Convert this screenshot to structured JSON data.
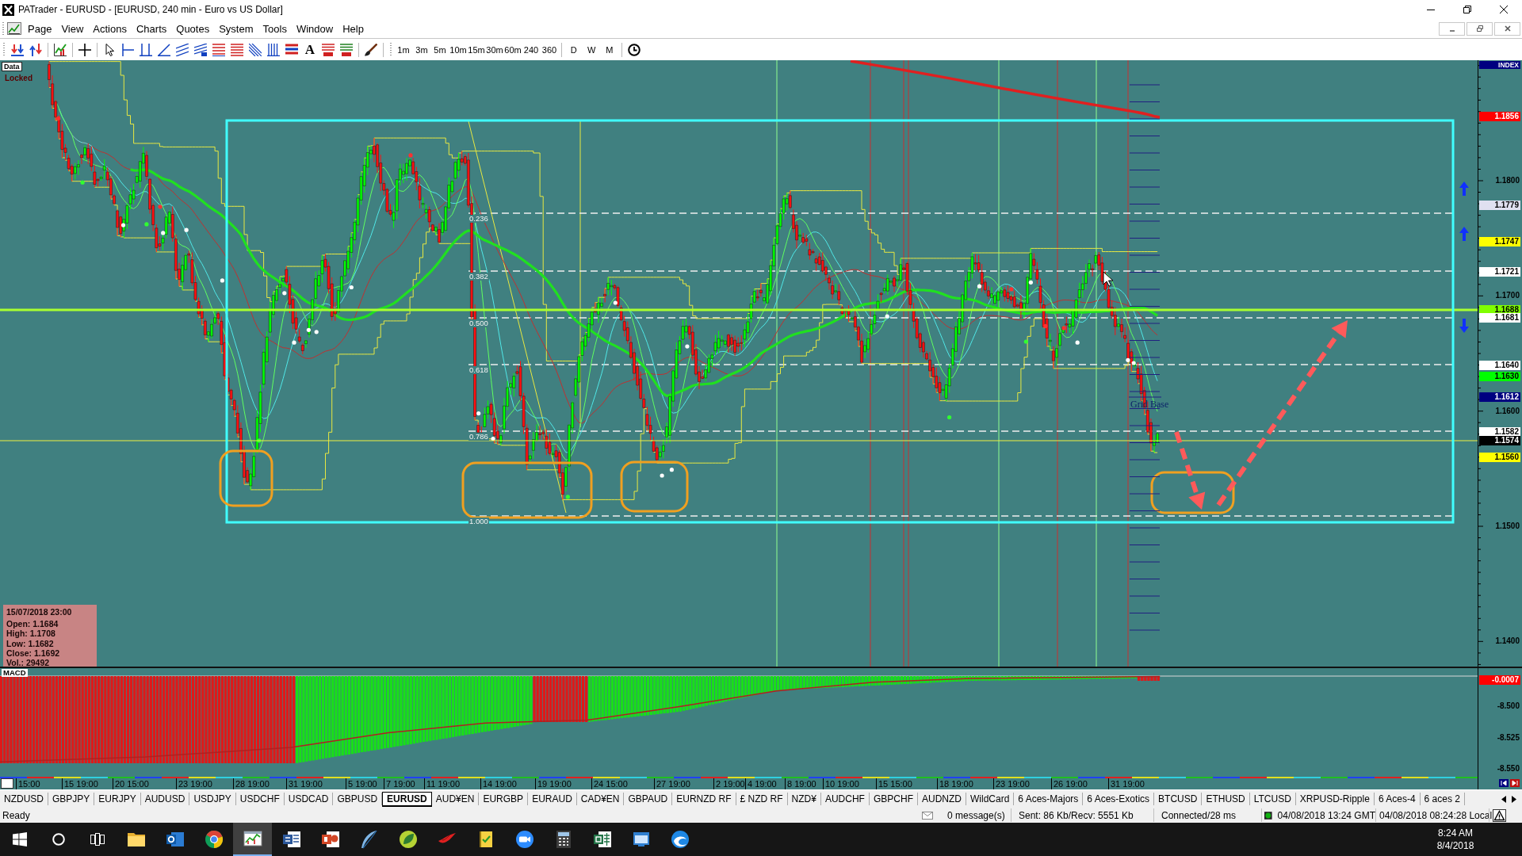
{
  "window": {
    "title": "PATrader - EURUSD - [EURUSD, 240 min - Euro vs US Dollar]"
  },
  "menu": [
    "Page",
    "View",
    "Actions",
    "Charts",
    "Quotes",
    "System",
    "Tools",
    "Window",
    "Help"
  ],
  "toolbar": {
    "text_tool": "A",
    "timeframes": [
      "1m",
      "3m",
      "5m",
      "10m",
      "15m",
      "30m",
      "60m",
      "240",
      "360"
    ],
    "periods": [
      "D",
      "W",
      "M"
    ]
  },
  "chart": {
    "corner": {
      "label": "Data",
      "lock_state": "Locked"
    },
    "price_axis": {
      "header": "INDEX",
      "ticks": [
        "1.1800",
        "1.1700",
        "1.1600",
        "1.1500",
        "1.1400"
      ],
      "markers": [
        {
          "label": "1.1856",
          "color": "#ff0000"
        },
        {
          "label": "1.1779",
          "color": "#e0e0f0"
        },
        {
          "label": "1.1747",
          "color": "#ffff00"
        },
        {
          "label": "1.1721",
          "color": "#ffffff"
        },
        {
          "label": "1.1688",
          "color": "#80ff00"
        },
        {
          "label": "1.1681",
          "color": "#ffffff"
        },
        {
          "label": "1.1640",
          "color": "#ffffff"
        },
        {
          "label": "1.1630",
          "color": "#00ff00"
        },
        {
          "label": "1.1612",
          "color": "#000080"
        },
        {
          "label": "1.1582",
          "color": "#ffffff"
        },
        {
          "label": "1.1574",
          "color": "#000000"
        },
        {
          "label": "1.1560",
          "color": "#ffff00"
        }
      ]
    },
    "fib_levels": [
      "0.236",
      "0.382",
      "0.500",
      "0.618",
      "0.786",
      "1.000"
    ],
    "grid_label": "Grid Base",
    "info_box": {
      "timestamp": "15/07/2018 23:00",
      "lines": [
        "Open: 1.1684",
        "High: 1.1708",
        "Low: 1.1682",
        "Close: 1.1692",
        "Vol.: 29492"
      ]
    },
    "macd": {
      "label": "MACD",
      "ticks": [
        "-8.500",
        "-8.525",
        "-8.550"
      ],
      "markers": [
        {
          "label": "-0.0007",
          "color": "#ff0000"
        }
      ]
    },
    "time_axis": [
      "15:00",
      "15 19:00",
      "20 15:00",
      "23 19:00",
      "28 19:00",
      "31 19:00",
      "5 19:00",
      "7 19:00",
      "11 19:00",
      "14 19:00",
      "19 19:00",
      "24 15:00",
      "27 19:00",
      "2 19:00",
      "4 19:00",
      "8 19:00",
      "10 19:00",
      "15 15:00",
      "18 19:00",
      "23 19:00",
      "26 19:00",
      "31 19:00"
    ]
  },
  "symbol_tabs": [
    {
      "label": "NZDUSD",
      "selected": false
    },
    {
      "label": "GBPJPY",
      "selected": false
    },
    {
      "label": "EURJPY",
      "selected": false
    },
    {
      "label": "AUDUSD",
      "selected": false
    },
    {
      "label": "USDJPY",
      "selected": false
    },
    {
      "label": "USDCHF",
      "selected": false
    },
    {
      "label": "USDCAD",
      "selected": false
    },
    {
      "label": "GBPUSD",
      "selected": false
    },
    {
      "label": "EURUSD",
      "selected": true
    },
    {
      "label": "AUD¥EN",
      "selected": false
    },
    {
      "label": "EURGBP",
      "selected": false
    },
    {
      "label": "EURAUD",
      "selected": false
    },
    {
      "label": "CAD¥EN",
      "selected": false
    },
    {
      "label": "GBPAUD",
      "selected": false
    },
    {
      "label": "EURNZD RF",
      "selected": false
    },
    {
      "label": "£ NZD RF",
      "selected": false
    },
    {
      "label": "NZD¥",
      "selected": false
    },
    {
      "label": "AUDCHF",
      "selected": false
    },
    {
      "label": "GBPCHF",
      "selected": false
    },
    {
      "label": "AUDNZD",
      "selected": false
    },
    {
      "label": "WildCard",
      "selected": false
    },
    {
      "label": "6 Aces-Majors",
      "selected": false
    },
    {
      "label": "6 Aces-Exotics",
      "selected": false
    },
    {
      "label": "BTCUSD",
      "selected": false
    },
    {
      "label": "ETHUSD",
      "selected": false
    },
    {
      "label": "LTCUSD",
      "selected": false
    },
    {
      "label": "XRPUSD-Ripple",
      "selected": false
    },
    {
      "label": "6 Aces-4",
      "selected": false
    },
    {
      "label": "6 aces 2",
      "selected": false
    }
  ],
  "status_bar": {
    "state": "Ready",
    "messages": "0 message(s)",
    "traffic": "Sent: 86 Kb/Recv: 5551 Kb",
    "connection": "Connected/28 ms",
    "gmt_time": "04/08/2018 13:24 GMT",
    "local_time": "04/08/2018 08:24:28 Local"
  },
  "taskbar": {
    "apps": [
      {
        "kind": "folder",
        "selected": false
      },
      {
        "kind": "mail",
        "selected": false
      },
      {
        "kind": "browser",
        "selected": false
      },
      {
        "kind": "chart",
        "selected": true
      },
      {
        "kind": "document",
        "selected": false
      },
      {
        "kind": "slides",
        "selected": false
      },
      {
        "kind": "feather",
        "selected": false
      },
      {
        "kind": "leaf",
        "selected": false
      },
      {
        "kind": "bird",
        "selected": false
      },
      {
        "kind": "notebook",
        "selected": false
      },
      {
        "kind": "camera",
        "selected": false
      },
      {
        "kind": "calculator",
        "selected": false
      },
      {
        "kind": "sheet",
        "selected": false
      },
      {
        "kind": "window",
        "selected": false
      },
      {
        "kind": "swirl",
        "selected": false
      }
    ],
    "time": "8:24 AM",
    "date": "8/4/2018"
  }
}
